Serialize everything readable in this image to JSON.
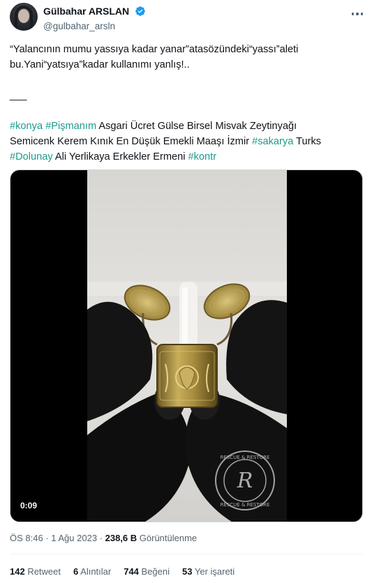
{
  "author": {
    "display_name": "Gülbahar ARSLAN",
    "handle": "@gulbahar_arsln"
  },
  "tweet": {
    "line1": "“Yalancının mumu yassıya kadar yanar”atasözündeki“yassı”aleti",
    "line2": "bu.Yani“yatsıya”kadar kullanımı yanlış!..",
    "separator": "___",
    "tags_line1": [
      {
        "text": "#konya",
        "tag": true
      },
      {
        "text": " ",
        "tag": false
      },
      {
        "text": "#Pişmanım",
        "tag": true
      },
      {
        "text": " Asgari Ücret Gülse Birsel Misvak Zeytinyağı",
        "tag": false
      }
    ],
    "tags_line2": [
      {
        "text": "Semicenk Kerem Kınık En Düşük Emekli Maaşı İzmir ",
        "tag": false
      },
      {
        "text": "#sakarya",
        "tag": true
      },
      {
        "text": " Turks",
        "tag": false
      }
    ],
    "tags_line3": [
      {
        "text": "#Dolunay",
        "tag": true
      },
      {
        "text": " Ali Yerlikaya Erkekler Ermeni ",
        "tag": false
      },
      {
        "text": "#kontr",
        "tag": true
      }
    ]
  },
  "media": {
    "duration": "0:09",
    "watermark_top": "RESCUE & RESTORE",
    "watermark_bottom": "RESCUE & RESTORE",
    "watermark_letter": "R"
  },
  "meta": {
    "time": "ÖS 8:46",
    "dot1": " · ",
    "date": "1 Ağu 2023",
    "dot2": " · ",
    "views_count": "238,6 B",
    "views_label": " Görüntülenme"
  },
  "stats": {
    "retweet_count": "142",
    "retweet_label": " Retweet",
    "quote_count": "6",
    "quote_label": " Alıntılar",
    "like_count": "744",
    "like_label": " Beğeni",
    "bookmark_count": "53",
    "bookmark_label": " Yer işareti"
  },
  "colors": {
    "hashtag": "#1d9b8a",
    "verified": "#1d9bf0",
    "secondary_text": "#536471"
  }
}
